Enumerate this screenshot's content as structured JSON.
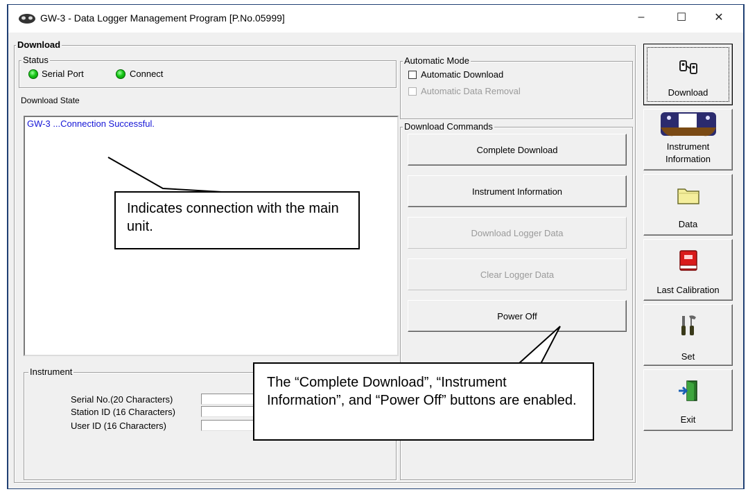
{
  "window": {
    "title": "GW-3 - Data Logger Management Program [P.No.05999]",
    "controls": {
      "minimize": "–",
      "maximize": "☐",
      "close": "✕"
    }
  },
  "download_panel": {
    "group_label": "Download",
    "status": {
      "label": "Status",
      "indicators": [
        {
          "label": "Serial Port",
          "color": "#16c616"
        },
        {
          "label": "Connect",
          "color": "#16c616"
        }
      ]
    },
    "download_state_label": "Download State",
    "log_text": "GW-3 ...Connection Successful.",
    "automatic_mode": {
      "label": "Automatic Mode",
      "options": [
        {
          "label": "Automatic Download",
          "checked": false,
          "enabled": true
        },
        {
          "label": "Automatic Data Removal",
          "checked": false,
          "enabled": false
        }
      ]
    },
    "commands": {
      "label": "Download Commands",
      "buttons": [
        {
          "label": "Complete Download",
          "enabled": true
        },
        {
          "label": "Instrument Information",
          "enabled": true
        },
        {
          "label": "Download Logger Data",
          "enabled": false
        },
        {
          "label": "Clear Logger Data",
          "enabled": false
        },
        {
          "label": "Power Off",
          "enabled": true
        }
      ]
    },
    "instrument": {
      "label": "Instrument",
      "fields": [
        {
          "label": "Serial No.(20 Characters)",
          "value": ""
        },
        {
          "label": "Station ID (16 Characters)",
          "value": ""
        },
        {
          "label": "User ID (16 Characters)",
          "value": ""
        }
      ]
    }
  },
  "sidebar": {
    "items": [
      {
        "label": "Download",
        "icon": "download-icon"
      },
      {
        "label": "Instrument Information",
        "icon": "instrument-icon"
      },
      {
        "label": "Data",
        "icon": "folder-icon"
      },
      {
        "label": "Last Calibration",
        "icon": "book-icon"
      },
      {
        "label": "Set",
        "icon": "tools-icon"
      },
      {
        "label": "Exit",
        "icon": "exit-icon"
      }
    ]
  },
  "callouts": {
    "connection": "Indicates connection with the main unit.",
    "buttons": "The “Complete Download”, “Instrument Information”, and “Power Off” buttons are enabled."
  }
}
